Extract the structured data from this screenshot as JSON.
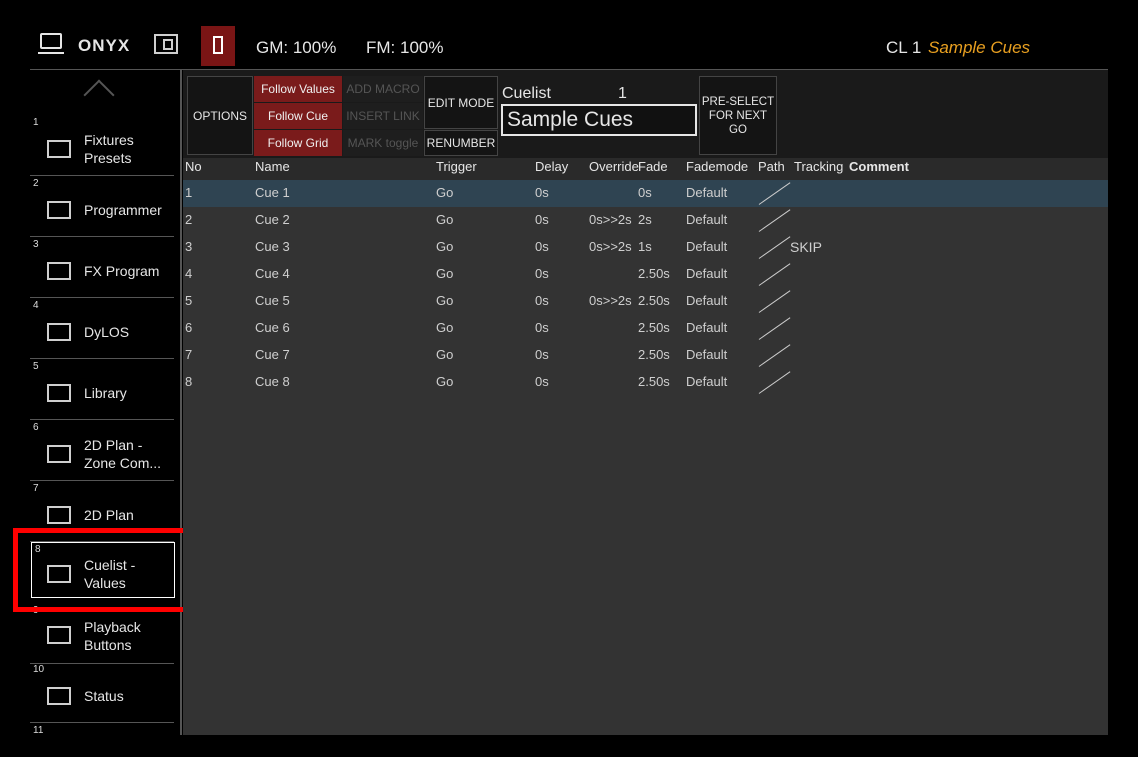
{
  "header": {
    "logo_text": "ONYX",
    "gm": "GM: 100%",
    "fm": "FM: 100%",
    "cl_number": "CL 1",
    "cl_name": "Sample Cues"
  },
  "sidebar": {
    "items": [
      {
        "num": "1",
        "label1": "Fixtures",
        "label2": "Presets"
      },
      {
        "num": "2",
        "label1": "Programmer",
        "label2": ""
      },
      {
        "num": "3",
        "label1": "FX Program",
        "label2": ""
      },
      {
        "num": "4",
        "label1": "DyLOS",
        "label2": ""
      },
      {
        "num": "5",
        "label1": "Library",
        "label2": ""
      },
      {
        "num": "6",
        "label1": "2D Plan -",
        "label2": "Zone Com..."
      },
      {
        "num": "7",
        "label1": "2D Plan",
        "label2": ""
      },
      {
        "num": "8",
        "label1": "Cuelist -",
        "label2": "Values"
      },
      {
        "num": "9",
        "label1": "Playback",
        "label2": "Buttons"
      },
      {
        "num": "10",
        "label1": "Status",
        "label2": ""
      },
      {
        "num": "11",
        "label1": "",
        "label2": ""
      }
    ]
  },
  "toolbar": {
    "options": "OPTIONS",
    "follow_values": "Follow Values",
    "follow_cue": "Follow  Cue",
    "follow_grid": "Follow Grid",
    "add_macro": "ADD MACRO",
    "insert_link": "INSERT LINK",
    "mark_toggle": "MARK toggle",
    "edit_mode": "EDIT MODE",
    "renumber": "RENUMBER",
    "cuelist_label": "Cuelist",
    "cuelist_number": "1",
    "cuelist_name": "Sample Cues",
    "preselect_1": "PRE-SELECT",
    "preselect_2": "FOR NEXT",
    "preselect_3": "GO"
  },
  "table": {
    "headers": {
      "no": "No",
      "name": "Name",
      "trigger": "Trigger",
      "delay": "Delay",
      "override": "Override",
      "fade": "Fade",
      "fademode": "Fademode",
      "path": "Path",
      "tracking": "Tracking",
      "comment": "Comment"
    },
    "rows": [
      {
        "no": "1",
        "name": "Cue 1",
        "trigger": "Go",
        "delay": "0s",
        "override": "",
        "fade": "0s",
        "fademode": "Default",
        "tracking": ""
      },
      {
        "no": "2",
        "name": "Cue 2",
        "trigger": "Go",
        "delay": "0s",
        "override": "0s>>2s",
        "fade": "2s",
        "fademode": "Default",
        "tracking": ""
      },
      {
        "no": "3",
        "name": "Cue 3",
        "trigger": "Go",
        "delay": "0s",
        "override": "0s>>2s",
        "fade": "1s",
        "fademode": "Default",
        "tracking": "SKIP"
      },
      {
        "no": "4",
        "name": "Cue 4",
        "trigger": "Go",
        "delay": "0s",
        "override": "",
        "fade": "2.50s",
        "fademode": "Default",
        "tracking": ""
      },
      {
        "no": "5",
        "name": "Cue 5",
        "trigger": "Go",
        "delay": "0s",
        "override": "0s>>2s",
        "fade": "2.50s",
        "fademode": "Default",
        "tracking": ""
      },
      {
        "no": "6",
        "name": "Cue 6",
        "trigger": "Go",
        "delay": "0s",
        "override": "",
        "fade": "2.50s",
        "fademode": "Default",
        "tracking": ""
      },
      {
        "no": "7",
        "name": "Cue 7",
        "trigger": "Go",
        "delay": "0s",
        "override": "",
        "fade": "2.50s",
        "fademode": "Default",
        "tracking": ""
      },
      {
        "no": "8",
        "name": "Cue 8",
        "trigger": "Go",
        "delay": "0s",
        "override": "",
        "fade": "2.50s",
        "fademode": "Default",
        "tracking": ""
      }
    ]
  },
  "colors": {
    "accent_red": "#7a1b1b",
    "cl_name": "#e9a020",
    "highlight": "#ff0000",
    "arrow": "#ffc000",
    "selected_row": "#2f4452"
  }
}
